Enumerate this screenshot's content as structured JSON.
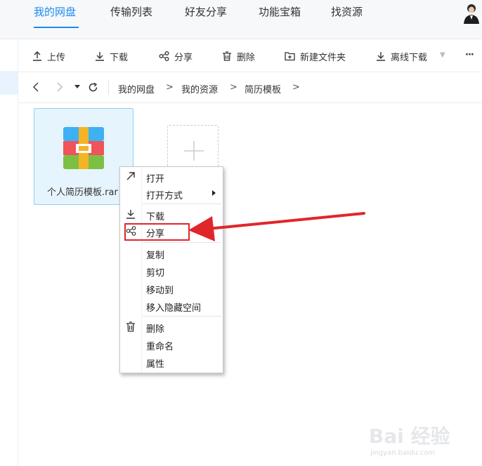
{
  "top_nav": {
    "tabs": [
      {
        "label": "我的网盘",
        "active": true
      },
      {
        "label": "传输列表",
        "active": false
      },
      {
        "label": "好友分享",
        "active": false
      },
      {
        "label": "功能宝箱",
        "active": false
      },
      {
        "label": "找资源",
        "active": false
      }
    ],
    "accent_color": "#1a8bf2"
  },
  "toolbar": {
    "upload_label": "上传",
    "download_label": "下载",
    "share_label": "分享",
    "delete_label": "删除",
    "new_folder_label": "新建文件夹",
    "offline_download_label": "离线下载",
    "more_label": "···"
  },
  "address_bar": {
    "crumbs": [
      "我的网盘",
      "我的资源",
      "简历模板"
    ],
    "separator": ">"
  },
  "files": [
    {
      "name": "个人简历模板.rar",
      "icon": "archive-icon",
      "selected": true
    }
  ],
  "context_menu": {
    "items": [
      {
        "label": "打开",
        "icon": "open-arrow-icon"
      },
      {
        "label": "打开方式",
        "submenu": true
      },
      {
        "label": "下载",
        "icon": "download-icon"
      },
      {
        "label": "分享",
        "icon": "share-icon",
        "highlighted": true
      },
      {
        "label": "复制"
      },
      {
        "label": "剪切"
      },
      {
        "label": "移动到"
      },
      {
        "label": "移入隐藏空间"
      },
      {
        "label": "删除",
        "icon": "trash-icon"
      },
      {
        "label": "重命名"
      },
      {
        "label": "属性"
      }
    ]
  },
  "annotation": {
    "color": "#e0262b"
  },
  "watermark": {
    "brand": "Bai 经验",
    "url": "jingyan.baidu.com"
  }
}
